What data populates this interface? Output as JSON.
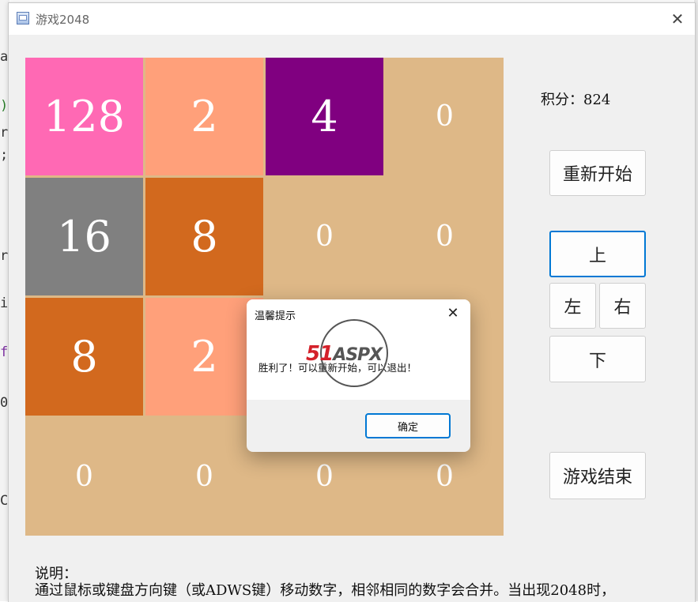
{
  "window": {
    "title": "游戏2048"
  },
  "board": {
    "tiles": [
      {
        "value": "128",
        "color": "#ff69b4"
      },
      {
        "value": "2",
        "color": "#ffa07a"
      },
      {
        "value": "4",
        "color": "#800080"
      },
      {
        "value": "0",
        "color": "#deb887"
      },
      {
        "value": "16",
        "color": "#808080"
      },
      {
        "value": "8",
        "color": "#d2691e"
      },
      {
        "value": "0",
        "color": "#deb887"
      },
      {
        "value": "0",
        "color": "#deb887"
      },
      {
        "value": "8",
        "color": "#d2691e"
      },
      {
        "value": "2",
        "color": "#ffa07a"
      },
      {
        "value": "",
        "color": "#deb887"
      },
      {
        "value": "",
        "color": "#deb887"
      },
      {
        "value": "0",
        "color": "#deb887"
      },
      {
        "value": "0",
        "color": "#deb887"
      },
      {
        "value": "0",
        "color": "#deb887"
      },
      {
        "value": "0",
        "color": "#deb887"
      }
    ]
  },
  "score": {
    "text": "积分：824"
  },
  "buttons": {
    "restart": "重新开始",
    "up": "上",
    "left": "左",
    "right": "右",
    "down": "下",
    "end": "游戏结束"
  },
  "description": {
    "heading": "说明：",
    "line1": "通过鼠标或键盘方向键（或ADWS键）移动数字，相邻相同的数字会合并。当出现2048时，"
  },
  "dialog": {
    "title": "温馨提示",
    "message": "胜利了！可以重新开始，可以退出！",
    "ok": "确定"
  },
  "watermark": {
    "text": "51ASPX"
  },
  "colors": {
    "accent": "#0078d4",
    "board": "#deb887"
  }
}
